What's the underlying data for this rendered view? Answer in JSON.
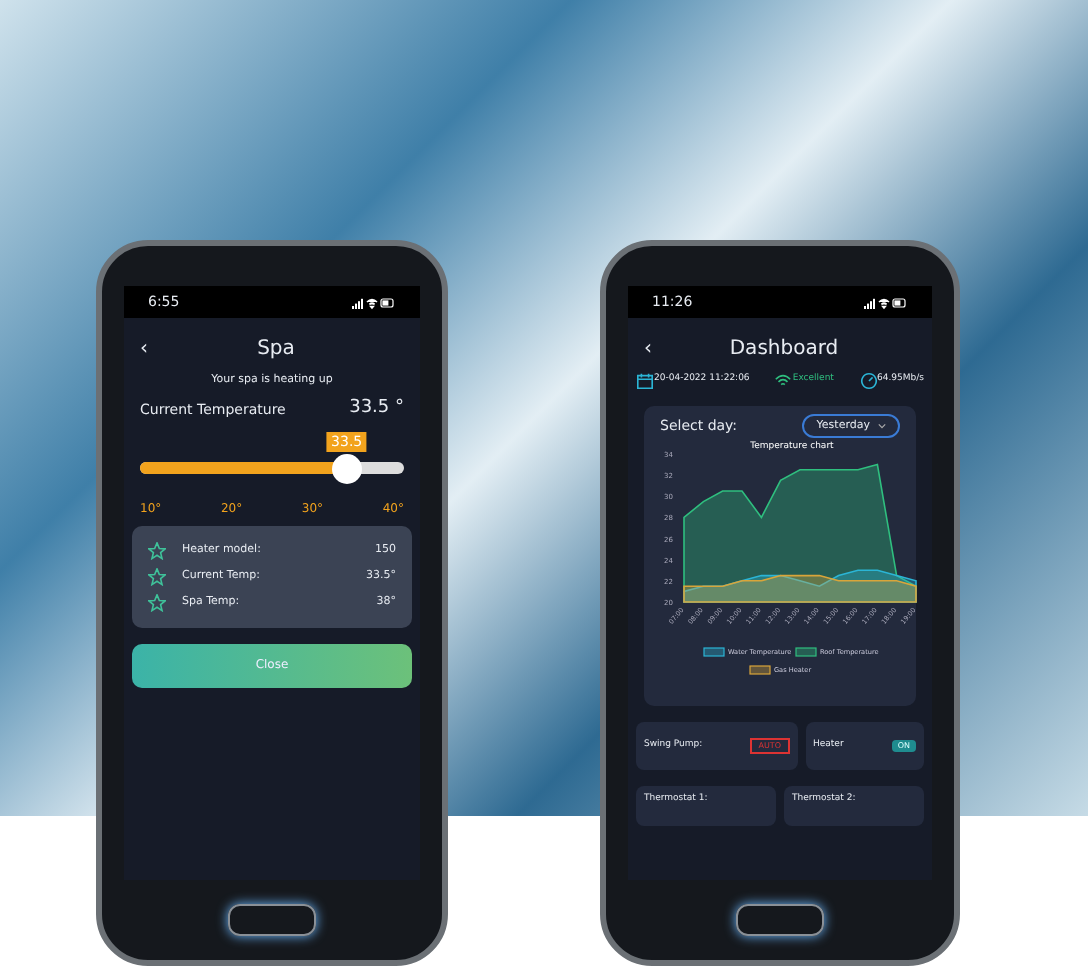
{
  "spa_screen": {
    "status_time": "6:55",
    "back": "‹",
    "title": "Spa",
    "subtitle": "Your spa is heating up",
    "current_label": "Current Temperature",
    "current_value": "33.5 °",
    "slider": {
      "badge": "33.5",
      "level": 0.783,
      "ticks": [
        "10°",
        "20°",
        "30°",
        "40°"
      ]
    },
    "info": [
      {
        "label": "Heater model:",
        "value": "150"
      },
      {
        "label": "Current Temp:",
        "value": "33.5°"
      },
      {
        "label": "Spa Temp:",
        "value": "38°"
      }
    ],
    "close_button": "Close"
  },
  "dashboard_screen": {
    "status_time": "11:26",
    "back": "‹",
    "title": "Dashboard",
    "date": "20-04-2022 11:22:06",
    "signal": "Excellent",
    "speed": "64.95Mb/s",
    "select_label": "Select day:",
    "select_value": "Yesterday",
    "chart_data": {
      "type": "area",
      "title": "Temperature chart",
      "legend": "bottom",
      "categories": [
        "07:00",
        "08:00",
        "09:00",
        "10:00",
        "11:00",
        "12:00",
        "13:00",
        "14:00",
        "15:00",
        "16:00",
        "17:00",
        "18:00",
        "19:00"
      ],
      "yticks": [
        20,
        22,
        24,
        26,
        28,
        30,
        32,
        34
      ],
      "ylim": [
        20,
        34
      ],
      "series": [
        {
          "name": "Water Temperature",
          "color": "#2bb5d6",
          "values": [
            21,
            21.5,
            21.5,
            22,
            22.5,
            22.5,
            22,
            21.5,
            22.5,
            23,
            23,
            22.5,
            22
          ]
        },
        {
          "name": "Roof Temperature",
          "color": "#2fbf7f",
          "values": [
            28,
            29.5,
            30.5,
            30.5,
            28,
            31.5,
            32.5,
            32.5,
            32.5,
            32.5,
            33,
            22.5,
            21.5
          ]
        },
        {
          "name": "Gas Heater",
          "color": "#d9a53a",
          "values": [
            21.5,
            21.5,
            21.5,
            22,
            22,
            22.5,
            22.5,
            22.5,
            22,
            22,
            22,
            22,
            21.5
          ]
        }
      ]
    },
    "cards": [
      {
        "label": "Swing Pump:",
        "kind": "badge",
        "value": "AUTO"
      },
      {
        "label": "Heater",
        "kind": "toggle",
        "value": "ON",
        "on": true
      }
    ],
    "partial_cards": [
      "Thermostat 1:",
      "Thermostat 2:"
    ]
  }
}
